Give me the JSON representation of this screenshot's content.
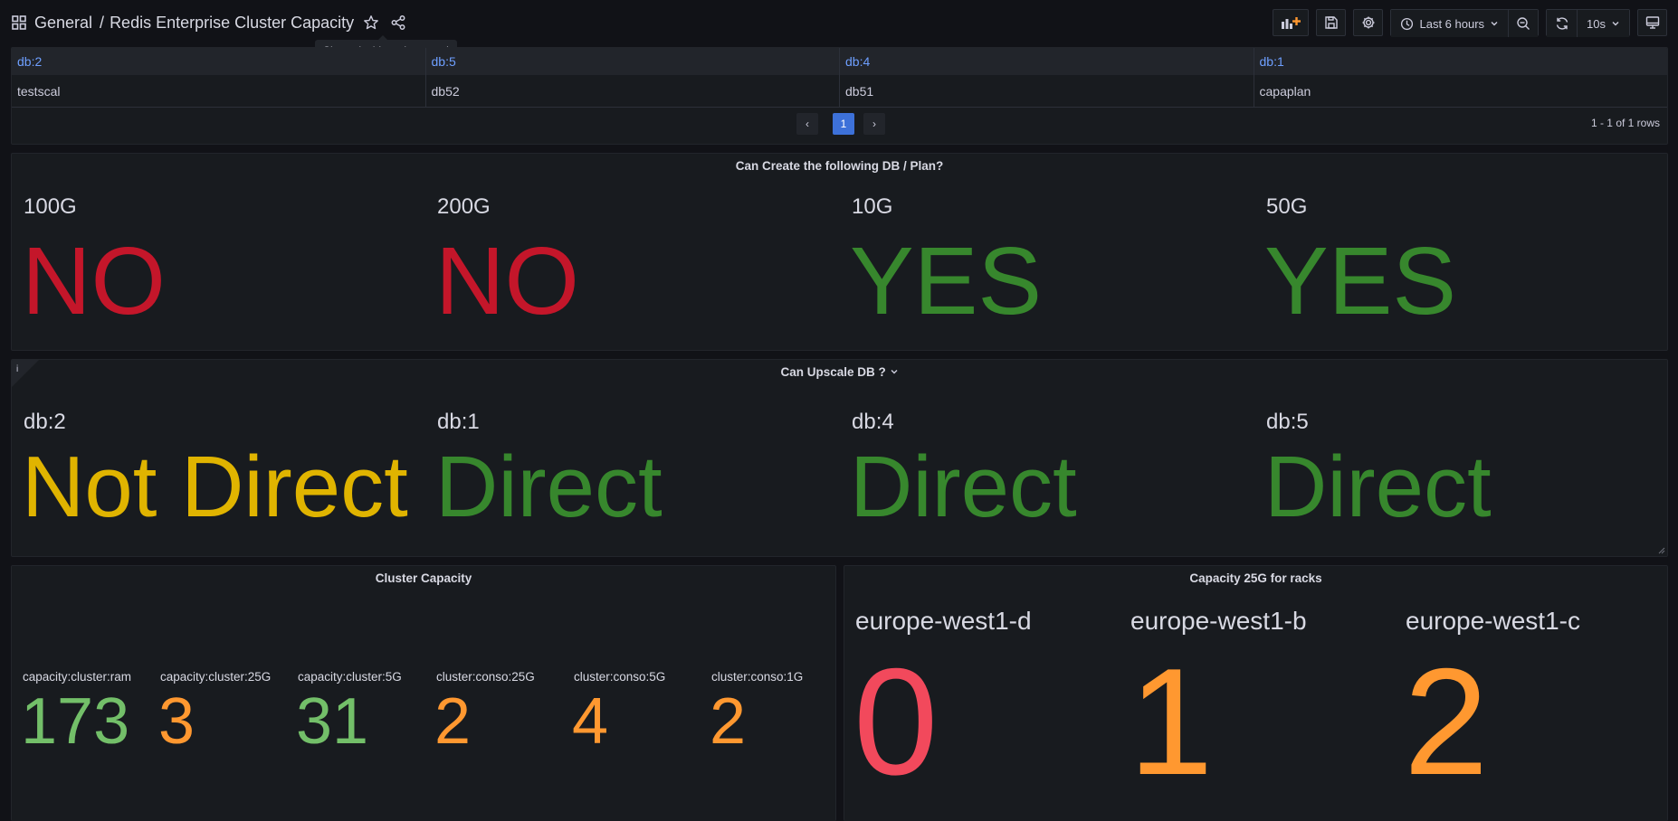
{
  "header": {
    "folder": "General",
    "separator": "/",
    "title": "Redis Enterprise Cluster Capacity",
    "tooltip": "Share dashboard or panel",
    "time_range": "Last 6 hours",
    "refresh": "10s"
  },
  "table": {
    "headers": [
      "db:2",
      "db:5",
      "db:4",
      "db:1"
    ],
    "row": [
      "testscal",
      "db52",
      "db51",
      "capaplan"
    ],
    "page": "1",
    "prev": "‹",
    "next": "›",
    "row_count": "1 - 1 of 1 rows"
  },
  "create_panel": {
    "title": "Can Create the following DB / Plan?",
    "items": [
      {
        "label": "100G",
        "value": "NO",
        "color": "#c4162a"
      },
      {
        "label": "200G",
        "value": "NO",
        "color": "#c4162a"
      },
      {
        "label": "10G",
        "value": "YES",
        "color": "#37872d"
      },
      {
        "label": "50G",
        "value": "YES",
        "color": "#37872d"
      }
    ]
  },
  "upscale_panel": {
    "title": "Can Upscale DB ?",
    "info": "i",
    "items": [
      {
        "label": "db:2",
        "value": "Not Direct",
        "color": "#e0b400"
      },
      {
        "label": "db:1",
        "value": "Direct",
        "color": "#37872d"
      },
      {
        "label": "db:4",
        "value": "Direct",
        "color": "#37872d"
      },
      {
        "label": "db:5",
        "value": "Direct",
        "color": "#37872d"
      }
    ]
  },
  "cluster_panel": {
    "title": "Cluster Capacity",
    "items": [
      {
        "label": "capacity:cluster:ram",
        "value": "173",
        "color": "#73bf69"
      },
      {
        "label": "capacity:cluster:25G",
        "value": "3",
        "color": "#ff9830"
      },
      {
        "label": "capacity:cluster:5G",
        "value": "31",
        "color": "#73bf69"
      },
      {
        "label": "cluster:conso:25G",
        "value": "2",
        "color": "#ff9830"
      },
      {
        "label": "cluster:conso:5G",
        "value": "4",
        "color": "#ff9830"
      },
      {
        "label": "cluster:conso:1G",
        "value": "2",
        "color": "#ff9830"
      }
    ]
  },
  "racks_panel": {
    "title": "Capacity 25G for racks",
    "items": [
      {
        "label": "europe-west1-d",
        "value": "0",
        "color": "#f2495c"
      },
      {
        "label": "europe-west1-b",
        "value": "1",
        "color": "#ff9830"
      },
      {
        "label": "europe-west1-c",
        "value": "2",
        "color": "#ff9830"
      }
    ]
  }
}
